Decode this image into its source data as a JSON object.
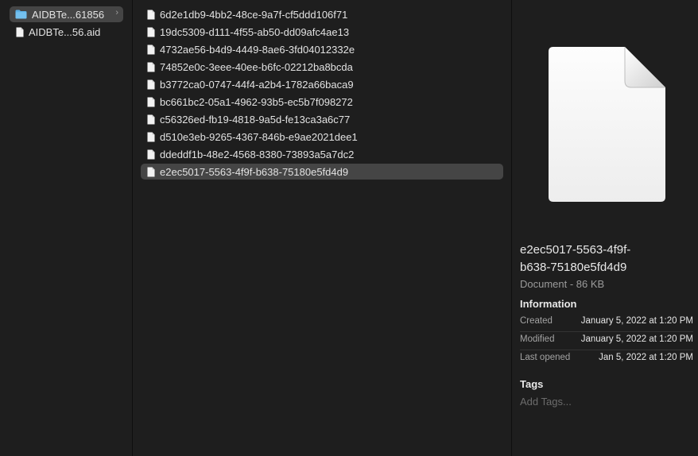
{
  "sidebar": {
    "items": [
      {
        "label": "AIDBTe...61856",
        "icon": "folder-icon",
        "selected": true,
        "chevron": "›"
      },
      {
        "label": "AIDBTe...56.aid",
        "icon": "document-icon",
        "selected": false
      }
    ]
  },
  "files": [
    "6d2e1db9-4bb2-48ce-9a7f-cf5ddd106f71",
    "19dc5309-d111-4f55-ab50-dd09afc4ae13",
    "4732ae56-b4d9-4449-8ae6-3fd04012332e",
    "74852e0c-3eee-40ee-b6fc-02212ba8bcda",
    "b3772ca0-0747-44f4-a2b4-1782a66baca9",
    "bc661bc2-05a1-4962-93b5-ec5b7f098272",
    "c56326ed-fb19-4818-9a5d-fe13ca3a6c77",
    "d510e3eb-9265-4367-846b-e9ae2021dee1",
    "ddeddf1b-48e2-4568-8380-73893a5a7dc2",
    "e2ec5017-5563-4f9f-b638-75180e5fd4d9"
  ],
  "selected_file_index": 9,
  "preview": {
    "name_line1": "e2ec5017-5563-4f9f-",
    "name_line2": "b638-75180e5fd4d9",
    "kind": "Document - 86 KB",
    "info_heading": "Information",
    "info": [
      {
        "key": "Created",
        "value": "January 5, 2022 at 1:20 PM"
      },
      {
        "key": "Modified",
        "value": "January 5, 2022 at 1:20 PM"
      },
      {
        "key": "Last opened",
        "value": "Jan 5, 2022 at 1:20 PM"
      }
    ],
    "tags_heading": "Tags",
    "tags_placeholder": "Add Tags..."
  },
  "colors": {
    "selection": "#454545",
    "folder": "#5ab0e6"
  }
}
